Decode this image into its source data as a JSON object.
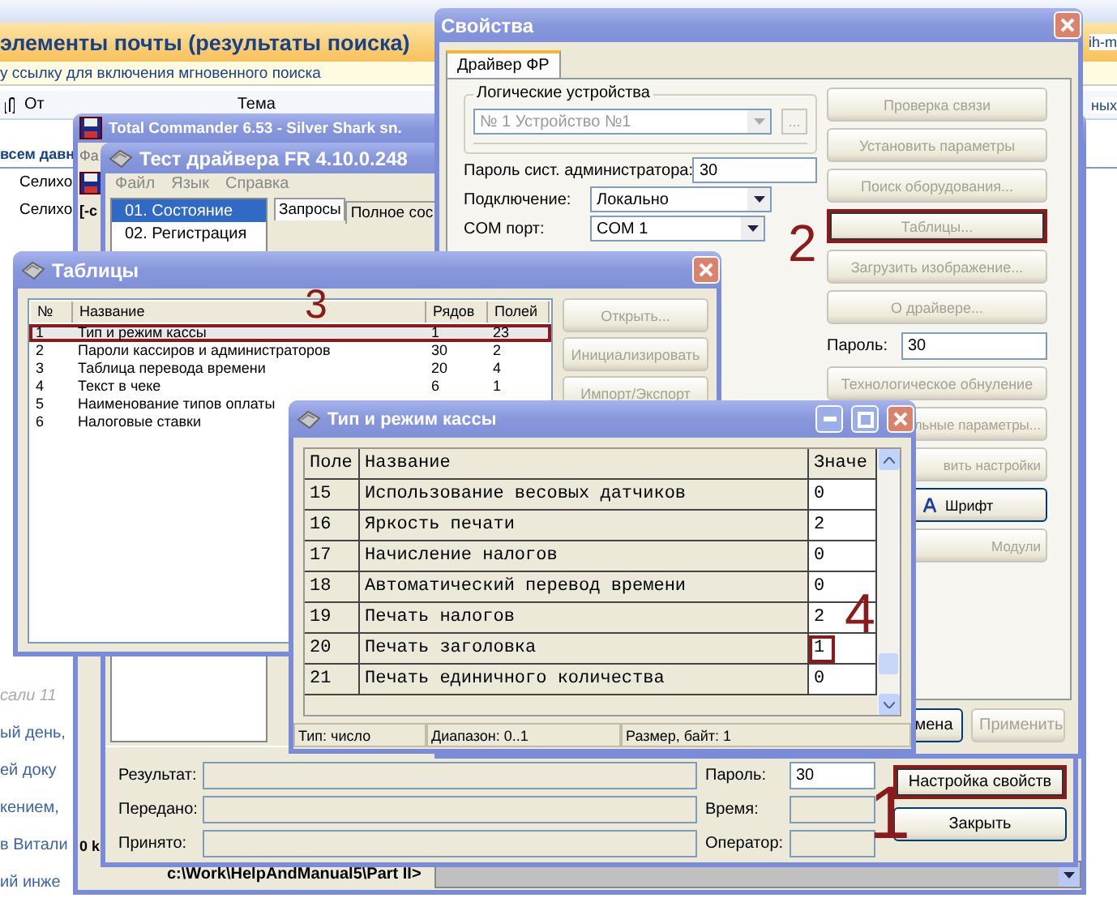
{
  "mail": {
    "title": "элементы почты (результаты поиска)",
    "title_fragment": "ih-m",
    "info_bar": "у ссылку для включения мгновенного поиска",
    "columns": [
      "От",
      "Тема"
    ],
    "header_fragment": "ных",
    "group": "всем давн",
    "rows": [
      "Селихо",
      "Селихо"
    ],
    "fragments": [
      {
        "text": "сали 11",
        "kind": "faded"
      },
      {
        "text": "ый день,",
        "kind": "link"
      },
      {
        "text": "ей доку",
        "kind": "link"
      },
      {
        "text": "кением,",
        "kind": "link"
      },
      {
        "text": "в Витали",
        "kind": "link"
      },
      {
        "text": "ий инже",
        "kind": "link"
      }
    ]
  },
  "file_manager": {
    "title": "Total Commander 6.53 - Silver Shark sn.",
    "menu_fragment": "Фа",
    "drive": "[-c",
    "free_space": "0 k",
    "path": "c:\\Work\\HelpAndManual5\\Part II>"
  },
  "test_window": {
    "title": "Тест драйвера FR 4.10.0.248",
    "menu": [
      "Файл",
      "Язык",
      "Справка"
    ],
    "sections": [
      {
        "label": "01. Состояние",
        "selected": true
      },
      {
        "label": "02. Регистрация",
        "selected": false
      }
    ],
    "tabs": [
      {
        "label": "Запросы",
        "selected": true
      },
      {
        "label": "Полное сос",
        "selected": false
      }
    ],
    "left_fields": [
      {
        "label": "Результат:"
      },
      {
        "label": "Передано:"
      },
      {
        "label": "Принято:"
      }
    ],
    "right_fields": [
      {
        "label": "Пароль:",
        "value": "30"
      },
      {
        "label": "Время:"
      },
      {
        "label": "Оператор:"
      }
    ],
    "buttons": [
      {
        "label": "Настройка свойств",
        "marked": true
      },
      {
        "label": "Закрыть",
        "marked": false
      }
    ],
    "annotation": "1"
  },
  "properties": {
    "title": "Свойства",
    "tabs": [
      {
        "label": "Драйвер ФР",
        "selected": true
      }
    ],
    "group_title": "Логические устройства",
    "device": "№ 1 Устройство №1",
    "browse": "...",
    "fields": [
      {
        "label": "Пароль сист. администратора:",
        "value": "30",
        "kind": "text"
      },
      {
        "label": "Подключение:",
        "value": "Локально",
        "kind": "combo"
      },
      {
        "label": "COM порт:",
        "value": "COM 1",
        "kind": "combo"
      }
    ],
    "side": [
      {
        "kind": "button",
        "label": "Проверка связи",
        "disabled": true,
        "marked": false
      },
      {
        "kind": "button",
        "label": "Установить параметры",
        "disabled": true,
        "marked": false
      },
      {
        "kind": "button",
        "label": "Поиск оборудования...",
        "disabled": true,
        "marked": false
      },
      {
        "kind": "button",
        "label": "Таблицы...",
        "disabled": true,
        "marked": true
      },
      {
        "kind": "button",
        "label": "Загрузить изображение...",
        "disabled": true,
        "marked": false
      },
      {
        "kind": "button",
        "label": "О драйвере...",
        "disabled": true,
        "marked": false
      },
      {
        "kind": "field",
        "label": "Пароль:",
        "value": "30"
      },
      {
        "kind": "button",
        "label": "Технологическое обнуление",
        "disabled": true,
        "marked": false
      },
      {
        "kind": "partial",
        "label": "льные параметры...",
        "disabled": true,
        "marked": false
      },
      {
        "kind": "partial",
        "label": "вить настройки",
        "disabled": true,
        "marked": false
      },
      {
        "kind": "font",
        "label": "Шрифт",
        "disabled": false,
        "marked": false
      },
      {
        "kind": "partial",
        "label": "Модули",
        "disabled": true,
        "marked": false
      }
    ],
    "footer": [
      {
        "label": "мена",
        "disabled": false
      },
      {
        "label": "Применить",
        "disabled": true
      }
    ],
    "annotation": "2"
  },
  "tables": {
    "title": "Таблицы",
    "columns": [
      "№",
      "Название",
      "Рядов",
      "Полей"
    ],
    "rows": [
      {
        "cells": [
          "1",
          "Тип и режим кассы",
          "1",
          "23"
        ],
        "selected": true,
        "marked": true
      },
      {
        "cells": [
          "2",
          "Пароли кассиров и администраторов",
          "30",
          "2"
        ],
        "selected": false,
        "marked": false
      },
      {
        "cells": [
          "3",
          "Таблица перевода времени",
          "20",
          "4"
        ],
        "selected": false,
        "marked": false
      },
      {
        "cells": [
          "4",
          "Текст в чеке",
          "6",
          "1"
        ],
        "selected": false,
        "marked": false
      },
      {
        "cells": [
          "5",
          "Наименование типов оплаты"
        ],
        "selected": false,
        "marked": false
      },
      {
        "cells": [
          "6",
          "Налоговые ставки"
        ],
        "selected": false,
        "marked": false
      }
    ],
    "buttons": [
      {
        "label": "Открыть...",
        "disabled": true
      },
      {
        "label": "Инициализировать",
        "disabled": true
      },
      {
        "label": "Импорт/Экспорт",
        "disabled": true
      }
    ],
    "annotation": "3"
  },
  "cash_mode": {
    "title": "Тип и режим кассы",
    "columns": [
      "Поле",
      "Название",
      "Значе"
    ],
    "rows": [
      {
        "field": "15",
        "name": "Использование весовых датчиков",
        "value": "0",
        "marked": false
      },
      {
        "field": "16",
        "name": "Яркость печати",
        "value": "2",
        "marked": false
      },
      {
        "field": "17",
        "name": "Начисление налогов",
        "value": "0",
        "marked": false
      },
      {
        "field": "18",
        "name": "Автоматический перевод времени",
        "value": "0",
        "marked": false
      },
      {
        "field": "19",
        "name": "Печать налогов",
        "value": "2",
        "marked": false
      },
      {
        "field": "20",
        "name": "Печать заголовка",
        "value": "1",
        "marked": true
      },
      {
        "field": "21",
        "name": "Печать единичного количества",
        "value": "0",
        "marked": false
      }
    ],
    "status": [
      "Тип: число",
      "Диапазон: 0..1",
      "Размер, байт: 1"
    ],
    "annotation": "4"
  }
}
